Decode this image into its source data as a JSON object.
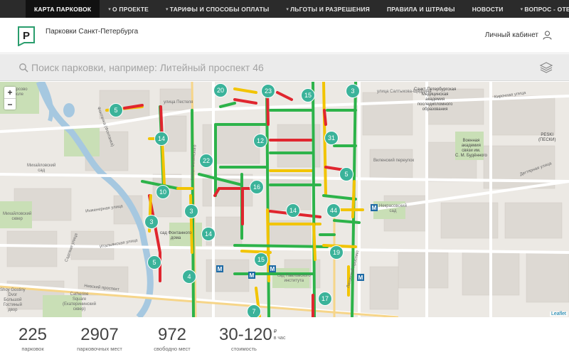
{
  "topnav": [
    {
      "label": "КАРТА ПАРКОВОК",
      "dropdown": false,
      "active": true
    },
    {
      "label": "О ПРОЕКТЕ",
      "dropdown": true,
      "active": false
    },
    {
      "label": "ТАРИФЫ И СПОСОБЫ ОПЛАТЫ",
      "dropdown": true,
      "active": false
    },
    {
      "label": "ЛЬГОТЫ И РАЗРЕШЕНИЯ",
      "dropdown": true,
      "active": false
    },
    {
      "label": "ПРАВИЛА И ШТРАФЫ",
      "dropdown": false,
      "active": false
    },
    {
      "label": "НОВОСТИ",
      "dropdown": false,
      "active": false
    },
    {
      "label": "ВОПРОС - ОТВЕТ",
      "dropdown": true,
      "active": false
    }
  ],
  "header": {
    "logo_letter": "P",
    "title": "Парковки Санкт-Петербурга",
    "account_label": "Личный кабинет"
  },
  "search": {
    "placeholder": "Поиск парковки, например: Литейный проспект 46"
  },
  "map": {
    "zoom_in": "+",
    "zoom_out": "−",
    "attribution": "Leaflet",
    "colors": {
      "free": "#2db34a",
      "medium": "#f2c400",
      "busy": "#e0262f",
      "cluster": "#3bb39a"
    },
    "clusters": [
      "5",
      "20",
      "23",
      "15",
      "3",
      "14",
      "12",
      "31",
      "22",
      "5",
      "16",
      "10",
      "3",
      "14",
      "44",
      "3",
      "14",
      "19",
      "5",
      "15",
      "4",
      "7",
      "17"
    ],
    "labels": [
      "Марсово\nполе",
      "улица Пестеля",
      "Фонтанка (Фонтанка)",
      "Михайловский\nсад",
      "Инженерная улица",
      "Михайловский\nсквер",
      "Садовая улица",
      "Итальянская улица",
      "сад Фонтанного\nдома",
      "улица Белинского",
      "Невский проспект",
      "Catherine\nSquare\n(Екатерининский\nсквер)",
      "Shoy Gostiny\nDvor\nБольшой\nГостиный\nдвор",
      "Санкт-Петербургская\nМедицинская\nакадемия\nпоследипломного\nобразования",
      "улица Салтыкова-Щедрина",
      "Кирочная улица",
      "Виленский переулок",
      "Военная\nакадемия\nсвязи им.\nС. М. Будённого",
      "PESKI\n(ПЕСКИ)",
      "сад Павловского\nинститута",
      "Некрасовский\nсад",
      "Дегтярная улица",
      "Лиговский проспект"
    ]
  },
  "stats": {
    "parkings": {
      "value": "225",
      "label": "парковок"
    },
    "spaces": {
      "value": "2907",
      "label": "парковочных мест"
    },
    "free": {
      "value": "972",
      "label": "свободно мест"
    },
    "price": {
      "value": "30-120",
      "unit_symbol": "₽",
      "unit_text": "в час",
      "label": "стоимость"
    }
  }
}
